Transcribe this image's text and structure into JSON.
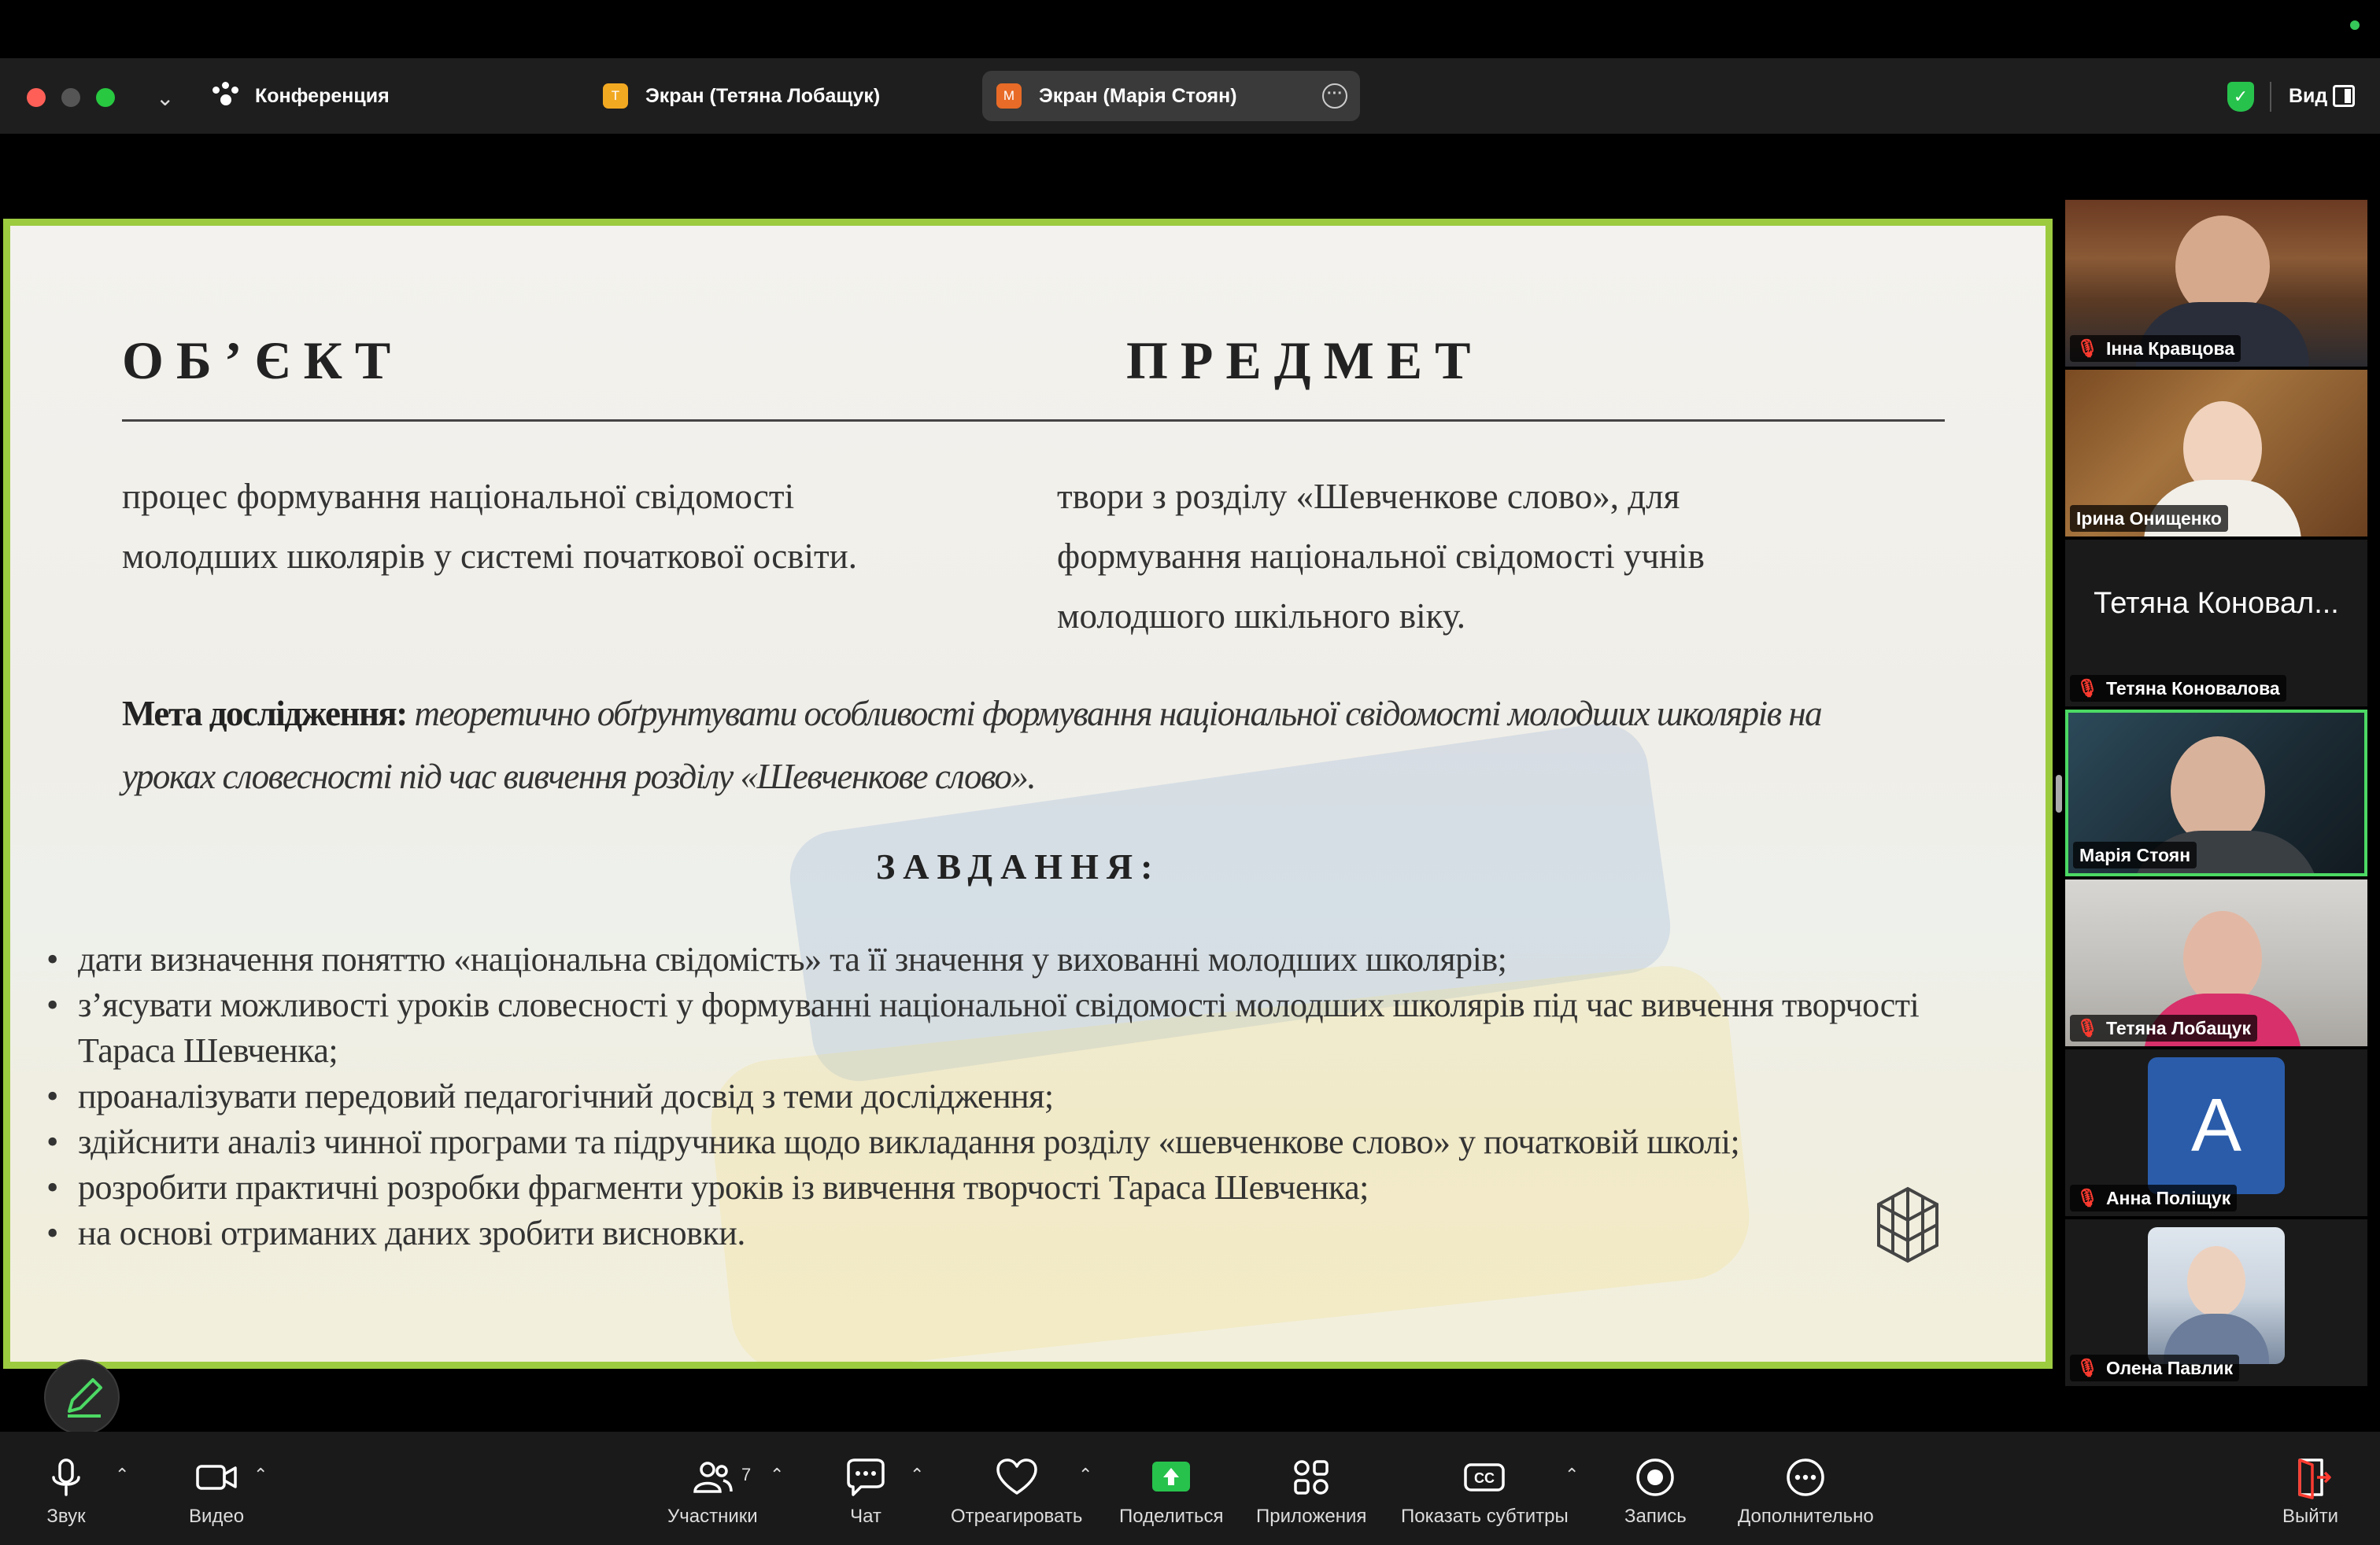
{
  "titlebar": {
    "conference_label": "Конференция",
    "tabs": [
      {
        "badge": "Т",
        "label": "Экран (Тетяна Лобащук)"
      },
      {
        "badge": "М",
        "label": "Экран (Марія Стоян)"
      }
    ],
    "view_label": "Вид"
  },
  "slide": {
    "object_heading": "ОБ’ЄКТ",
    "subject_heading": "ПРЕДМЕТ",
    "object_line1": "процес формування національної свідомості",
    "object_line2": "молодших школярів у системі початкової освіти.",
    "subject_line1": "твори з розділу «Шевченкове слово», для",
    "subject_line2": "формування національної свідомості учнів",
    "subject_line3": "молодшого шкільного віку.",
    "goal_label": "Мета дослідження:",
    "goal_text": " теоретично обґрунтувати особливості формування національної свідомості молодших школярів на уроках словесності під час вивчення розділу «Шевченкове слово».",
    "tasks_heading": "ЗАВДАННЯ:",
    "tasks": [
      "дати визначення поняттю «національна свідомість» та її значення у вихованні молодших школярів;",
      "з’ясувати можливості уроків словесності у формуванні національної свідомості молодших школярів під час вивчення творчості Тараса Шевченка;",
      "проаналізувати передовий педагогічний досвід з теми дослідження;",
      "здійснити аналіз чинної програми та підручника щодо викладання розділу «шевченкове слово» у початковій школі;",
      "розробити практичні розробки фрагменти уроків із вивчення творчості Тараса Шевченка;",
      "на основі отриманих даних зробити висновки."
    ]
  },
  "participants": [
    {
      "name": "Інна Кравцова"
    },
    {
      "name": "Ірина Онищенко"
    },
    {
      "name": "Тетяна Коновалова",
      "big": "Тетяна Коновал..."
    },
    {
      "name": "Марія Стоян"
    },
    {
      "name": "Тетяна Лобащук"
    },
    {
      "name": "Анна Поліщук",
      "avatar": "A"
    },
    {
      "name": "Олена Павлик"
    }
  ],
  "toolbar": {
    "audio": "Звук",
    "video": "Видео",
    "participants": "Участники",
    "participants_count": "7",
    "chat": "Чат",
    "react": "Отреагировать",
    "share": "Поделиться",
    "apps": "Приложения",
    "captions": "Показать субтитры",
    "record": "Запись",
    "more": "Дополнительно",
    "leave": "Выйти"
  },
  "colors": {
    "speaker_border": "#4cd964",
    "slide_border": "#9ccb3f",
    "share_green": "#27c24c",
    "mute_red": "#ff3b30"
  }
}
